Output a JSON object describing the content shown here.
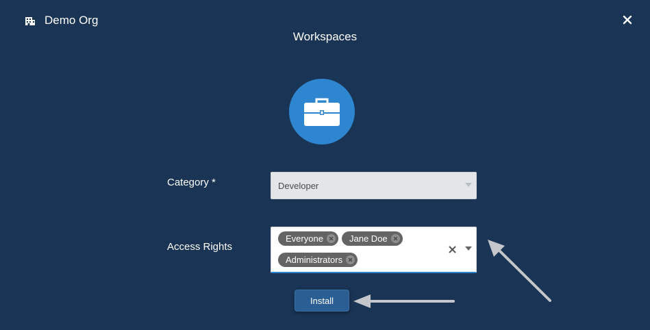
{
  "header": {
    "org_name": "Demo Org",
    "org_icon": "building-icon",
    "close_icon": "close-icon"
  },
  "page": {
    "title": "Workspaces",
    "app_icon": "briefcase-icon"
  },
  "form": {
    "category": {
      "label": "Category *",
      "value": "Developer"
    },
    "access_rights": {
      "label": "Access Rights",
      "tags": [
        "Everyone",
        "Jane Doe",
        "Administrators"
      ]
    },
    "install_label": "Install"
  },
  "colors": {
    "background": "#193454",
    "icon_circle": "#2f86d0",
    "button": "#2b5f93",
    "tag": "#646464",
    "annotation_arrow": "#c3c6ca"
  }
}
